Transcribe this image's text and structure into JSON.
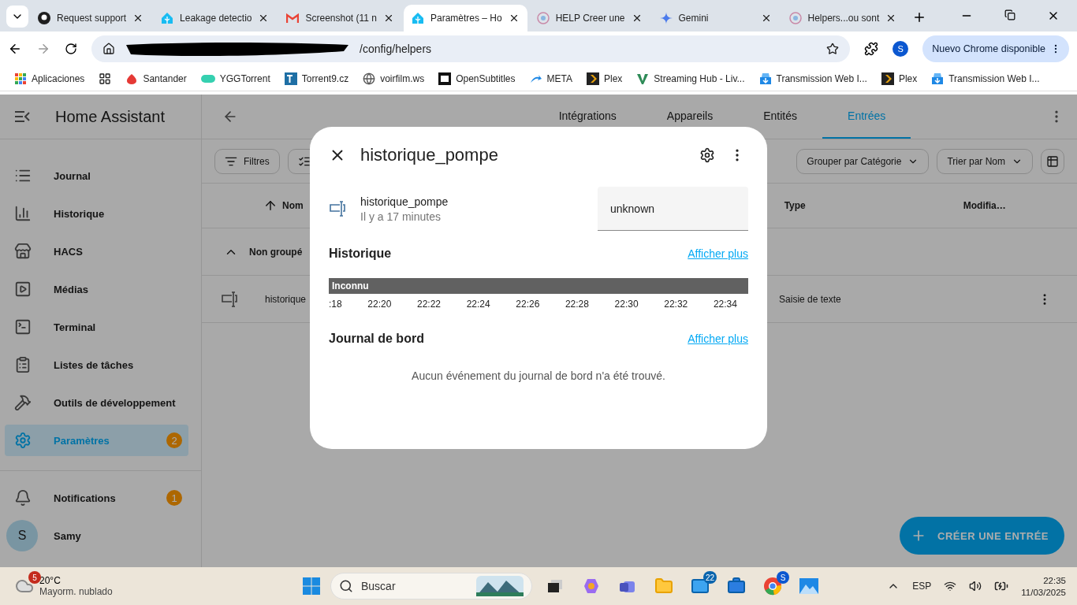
{
  "browser": {
    "tabs": [
      {
        "title": "Request support",
        "selected": false
      },
      {
        "title": "Leakage detectio",
        "selected": false
      },
      {
        "title": "Screenshot (11 n",
        "selected": false
      },
      {
        "title": "Paramètres – Ho",
        "selected": true
      },
      {
        "title": "HELP Creer une",
        "selected": false
      },
      {
        "title": "Gemini",
        "selected": false
      },
      {
        "title": "Helpers...ou sont",
        "selected": false
      }
    ],
    "url": "/config/helpers",
    "profile": "S",
    "update_button": "Nuevo Chrome disponible",
    "bookmarks": [
      {
        "label": "Aplicaciones"
      },
      {
        "label": "Santander"
      },
      {
        "label": "YGGTorrent"
      },
      {
        "label": "Torrent9.cz"
      },
      {
        "label": "voirfilm.ws"
      },
      {
        "label": "OpenSubtitles"
      },
      {
        "label": "META"
      },
      {
        "label": "Plex"
      },
      {
        "label": "Streaming Hub - Liv..."
      },
      {
        "label": "Transmission Web I..."
      },
      {
        "label": "Plex"
      },
      {
        "label": "Transmission Web I..."
      }
    ]
  },
  "sidebar": {
    "title": "Home Assistant",
    "items": [
      {
        "label": "Journal",
        "selected": false
      },
      {
        "label": "Historique",
        "selected": false
      },
      {
        "label": "HACS",
        "selected": false
      },
      {
        "label": "Médias",
        "selected": false
      },
      {
        "label": "Terminal",
        "selected": false
      },
      {
        "label": "Listes de tâches",
        "selected": false
      },
      {
        "label": "Outils de développement",
        "selected": false
      },
      {
        "label": "Paramètres",
        "selected": true,
        "badge": "2"
      }
    ],
    "notifications": {
      "label": "Notifications",
      "badge": "1"
    },
    "user": {
      "initial": "S",
      "name": "Samy"
    }
  },
  "main": {
    "tabs": [
      {
        "label": "Intégrations",
        "selected": false
      },
      {
        "label": "Appareils",
        "selected": false
      },
      {
        "label": "Entités",
        "selected": false
      },
      {
        "label": "Entrées",
        "selected": true
      }
    ],
    "filters_button": "Filtres",
    "group_button": "Grouper par Catégorie",
    "sort_button": "Trier par Nom",
    "table": {
      "columns": [
        "Nom",
        "Type",
        "Modifia…"
      ],
      "group": "Non groupé",
      "rows": [
        {
          "name": "historique",
          "type": "Saisie de texte"
        }
      ]
    },
    "fab": "CRÉER UNE ENTRÉE"
  },
  "dialog": {
    "title": "historique_pompe",
    "entity": {
      "name": "historique_pompe",
      "time": "Il y a 17 minutes",
      "value": "unknown"
    },
    "history": {
      "heading": "Historique",
      "link": "Afficher plus",
      "state": "Inconnu",
      "ticks": [
        ":18",
        "22:20",
        "22:22",
        "22:24",
        "22:26",
        "22:28",
        "22:30",
        "22:32",
        "22:34"
      ]
    },
    "logbook": {
      "heading": "Journal de bord",
      "link": "Afficher plus",
      "empty": "Aucun événement du journal de bord n'a été trouvé."
    }
  },
  "taskbar": {
    "weather": {
      "badge": "5",
      "temp": "20°C",
      "desc": "Mayorm. nublado"
    },
    "search": "Buscar",
    "mail_badge": "22",
    "chrome_badge": "S",
    "language": "ESP",
    "time": "22:35",
    "date": "11/03/2025"
  }
}
